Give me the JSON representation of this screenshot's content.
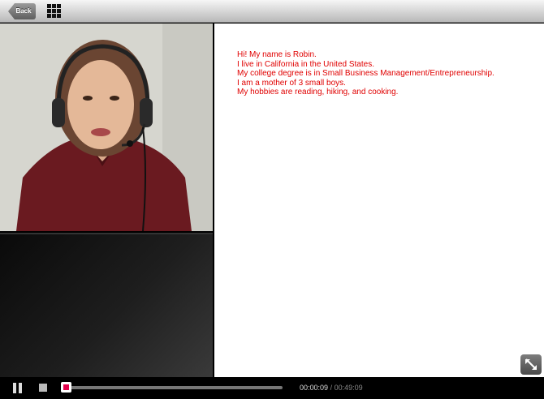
{
  "toolbar": {
    "back_label": "Back",
    "grid_icon": "grid-icon"
  },
  "content": {
    "lines": [
      "Hi! My name is Robin.",
      "I live in California in the United States.",
      "My college degree is in Small Business Management/Entrepreneurship.",
      "I am a mother of 3 small boys.",
      "My hobbies are reading, hiking, and cooking."
    ],
    "text_color": "#e00000"
  },
  "player": {
    "current_time": "00:00:09",
    "separator": "/",
    "total_time": "00:49:09",
    "progress_fraction": 0.003,
    "pause_icon": "pause-icon",
    "stop_icon": "stop-icon",
    "expand_icon": "expand-icon",
    "accent": "#e2004a"
  }
}
